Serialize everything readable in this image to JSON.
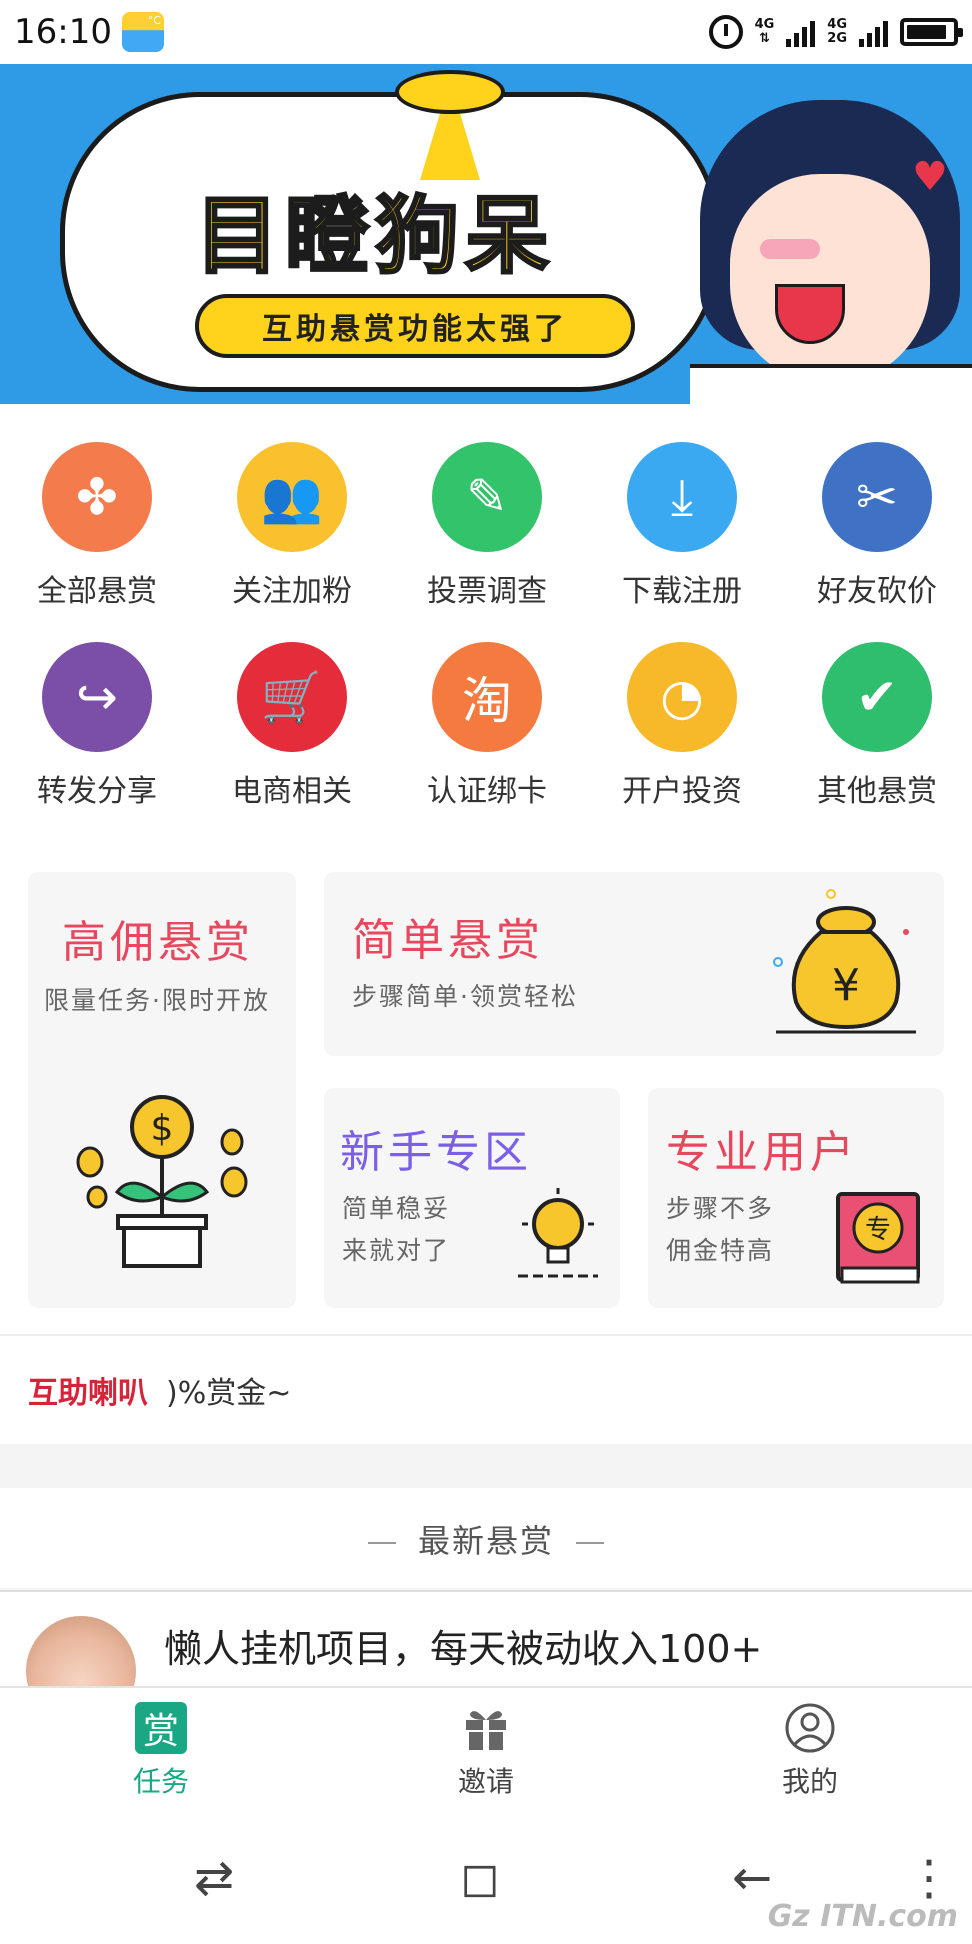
{
  "status_bar": {
    "time": "16:10",
    "weather_badge": "°C",
    "net_top": "4G",
    "net_bottom": "4G",
    "net_bottom2": "2G",
    "icons": [
      "weather-icon",
      "alarm-icon",
      "signal-icon",
      "battery-icon"
    ]
  },
  "banner": {
    "title": "目瞪狗呆",
    "subtitle": "互助悬赏功能太强了",
    "page_count": 2,
    "active_page": 2
  },
  "categories": [
    {
      "label": "全部悬赏",
      "color": "#f47c4c",
      "glyph": "✤",
      "icon": "clover-icon"
    },
    {
      "label": "关注加粉",
      "color": "#f9c12e",
      "glyph": "👥",
      "icon": "users-icon"
    },
    {
      "label": "投票调查",
      "color": "#33c36b",
      "glyph": "✎",
      "icon": "edit-icon"
    },
    {
      "label": "下载注册",
      "color": "#3aa9f2",
      "glyph": "⤓",
      "icon": "download-icon"
    },
    {
      "label": "好友砍价",
      "color": "#3f72c4",
      "glyph": "✂",
      "icon": "tag-cut-icon"
    },
    {
      "label": "转发分享",
      "color": "#7b4fa8",
      "glyph": "↪",
      "icon": "share-icon"
    },
    {
      "label": "电商相关",
      "color": "#e42c3a",
      "glyph": "🛒",
      "icon": "cart-icon"
    },
    {
      "label": "认证绑卡",
      "color": "#f57a3f",
      "glyph": "淘",
      "icon": "taobao-icon"
    },
    {
      "label": "开户投资",
      "color": "#f7b92a",
      "glyph": "◔",
      "icon": "orange-icon"
    },
    {
      "label": "其他悬赏",
      "color": "#2fbd6e",
      "glyph": "✔",
      "icon": "calendar-check-icon"
    }
  ],
  "features": {
    "high": {
      "title": "高佣悬赏",
      "subtitle": "限量任务·限时开放",
      "color": "#e8475e"
    },
    "simple": {
      "title": "简单悬赏",
      "subtitle": "步骤简单·领赏轻松",
      "color": "#e8475e"
    },
    "newbie": {
      "title": "新手专区",
      "line1": "简单稳妥",
      "line2": "来就对了",
      "color": "#7b5fe6"
    },
    "pro": {
      "title": "专业用户",
      "line1": "步骤不多",
      "line2": "佣金特高",
      "color": "#e8475e",
      "badge": "专"
    },
    "money_symbol": "¥",
    "dollar_symbol": "$"
  },
  "horn": {
    "label": "互助喇叭",
    "text": ")%赏金~"
  },
  "latest": {
    "heading": "最新悬赏",
    "items": [
      {
        "title": "懒人挂机项目，每天被动收入100+"
      }
    ]
  },
  "tabs": [
    {
      "label": "任务",
      "icon": "reward-icon",
      "glyph": "赏",
      "active": true
    },
    {
      "label": "邀请",
      "icon": "gift-icon",
      "glyph": "",
      "active": false
    },
    {
      "label": "我的",
      "icon": "profile-icon",
      "glyph": "",
      "active": false
    }
  ],
  "nav": {
    "switch": "⇄",
    "home": "◻",
    "back": "←",
    "menu": "⋮"
  },
  "watermark": "Gz ITN.com"
}
